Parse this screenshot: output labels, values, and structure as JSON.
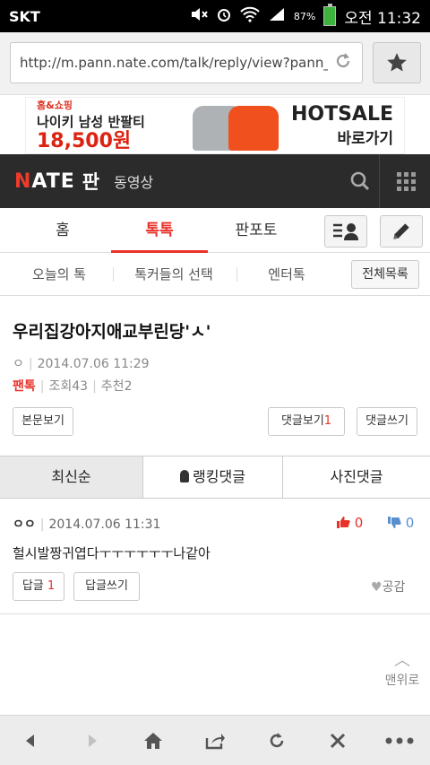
{
  "status_bar": {
    "carrier": "SKT",
    "battery_percent": "87%",
    "ampm": "오전",
    "time": "11:32"
  },
  "browser": {
    "url": "http://m.pann.nate.com/talk/reply/view?pann_id=323",
    "reload_icon": "reload-icon",
    "bookmark_icon": "star-icon"
  },
  "ad": {
    "store": "홈&쇼핑",
    "product": "나이키 남성 반팔티",
    "price": "18,500원",
    "headline": "HOTSALE",
    "cta": "바로가기"
  },
  "site_header": {
    "logo_hl": "N",
    "logo_rest": "ATE",
    "section": "판",
    "video_link": "동영상"
  },
  "main_tabs": {
    "home": "홈",
    "toktok": "톡톡",
    "panphoto": "판포토"
  },
  "sub_tabs": {
    "today": "오늘의 톡",
    "picks": "톡커들의 선택",
    "enter": "엔터톡",
    "all_list": "전체목록"
  },
  "post": {
    "title": "우리집강아지애교부린당'ㅅ'",
    "author": "ㅇ",
    "datetime": "2014.07.06 11:29",
    "category": "팬톡",
    "views_label": "조회",
    "views": "43",
    "recommend_label": "추천",
    "recommend": "2"
  },
  "post_buttons": {
    "view_body": "본문보기",
    "view_comments": "댓글보기",
    "comment_count": "1",
    "write_comment": "댓글쓰기"
  },
  "comment_tabs": {
    "latest": "최신순",
    "ranking": "랭킹댓글",
    "photo": "사진댓글"
  },
  "comment": {
    "author": "ㅇㅇ",
    "datetime": "2014.07.06 11:31",
    "likes": "0",
    "dislikes": "0",
    "text": "헐시발짱귀엽다ㅜㅜㅜㅜㅜㅜ나같아",
    "reply_label": "답글",
    "reply_count": "1",
    "write_reply": "답글쓰기",
    "sympathy": "공감"
  },
  "to_top": "맨위로",
  "colors": {
    "accent": "#e8322a",
    "header_bg": "#2b2b2b"
  }
}
